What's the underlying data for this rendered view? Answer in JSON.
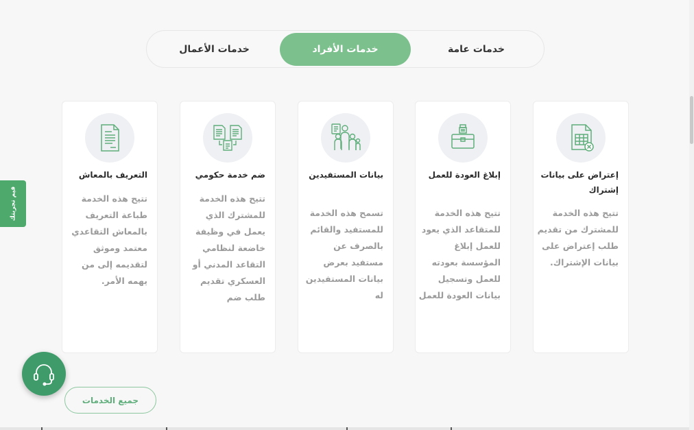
{
  "tabs": [
    {
      "label": "خدمات عامة",
      "active": false
    },
    {
      "label": "خدمات الأفراد",
      "active": true
    },
    {
      "label": "خدمات الأعمال",
      "active": false
    }
  ],
  "cards": [
    {
      "title": "إعتراض على بيانات إشتراك",
      "description": "تتيح هذه الخدمة للمشترك من تقديم طلب إعتراض على بيانات الإشتراك.",
      "icon": "spreadsheet-objection-icon"
    },
    {
      "title": "إبلاغ العودة للعمل",
      "description": "تتيح هذه الخدمة للمتقاعد الذي يعود للعمل إبلاغ المؤسسة بعودته للعمل وتسجيل بيانات العودة للعمل",
      "icon": "briefcase-icon"
    },
    {
      "title": "بيانات المستفيدين",
      "description": "تسمح هذه الخدمة للمستفيد والقائم بالصرف عن مستفيد بعرض بيانات المستفيدين له",
      "icon": "family-group-icon"
    },
    {
      "title": "ضم خدمة حكومي",
      "description": "تتيح هذه الخدمة للمشترك الذي يعمل في وظيفة خاضعة لنظامي التقاعد المدني أو العسكري تقديم طلب ضم",
      "icon": "document-merge-icon"
    },
    {
      "title": "التعريف بالمعاش",
      "description": "تتيح هذه الخدمة طباعة التعريف بالمعاش التقاعدي معتمد وموثق لتقديمه إلى من يهمه الأمر.",
      "icon": "document-icon"
    }
  ],
  "side_tab": {
    "label": "قيم تجربتك"
  },
  "all_services": {
    "label": "جميع الخدمات"
  },
  "support": {
    "icon": "headset-icon"
  },
  "colors": {
    "accent": "#7cc08e",
    "dark_green": "#3f9c6a",
    "side_tab": "#4daa6c",
    "icon_stroke": "#5fae7b"
  }
}
